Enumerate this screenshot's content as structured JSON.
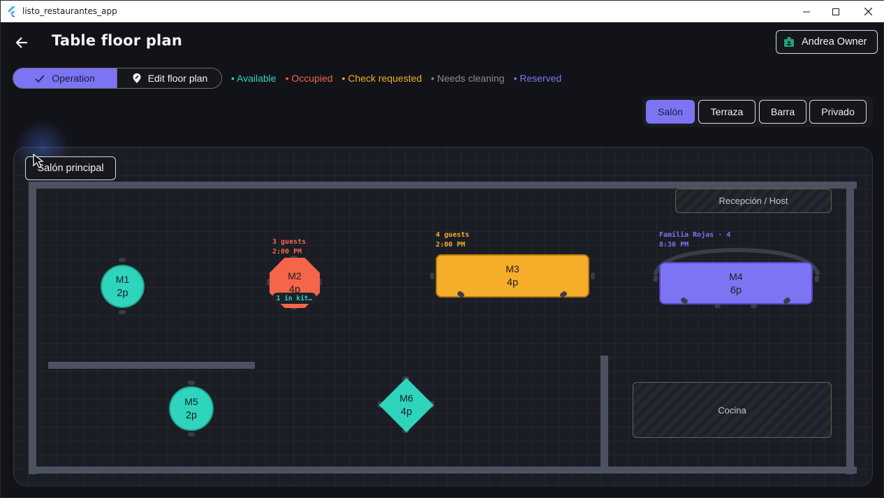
{
  "window": {
    "title": "listo_restaurantes_app"
  },
  "header": {
    "title": "Table floor plan",
    "user_label": "Andrea Owner"
  },
  "mode": {
    "operation_label": "Operation",
    "edit_label": "Edit floor plan"
  },
  "legend": [
    {
      "label": "• Available",
      "color": "#2fd4bc"
    },
    {
      "label": "• Occupied",
      "color": "#f4654a"
    },
    {
      "label": "• Check requested",
      "color": "#f5ad2a"
    },
    {
      "label": "• Needs cleaning",
      "color": "#8a8d96"
    },
    {
      "label": "• Reserved",
      "color": "#7c74f2"
    }
  ],
  "areas": {
    "tabs": [
      "Salón",
      "Terraza",
      "Barra",
      "Privado"
    ],
    "active": "Salón"
  },
  "floor": {
    "room_label": "Salón principal",
    "zones": {
      "host": "Recepción / Host",
      "kitchen": "Cocina"
    },
    "tables": {
      "m1": {
        "name": "M1",
        "capacity": "2p"
      },
      "m2": {
        "name": "M2",
        "capacity": "4p",
        "info_line1": "3 guests",
        "info_line2": "2:00 PM",
        "kitchen": "1 in kit…"
      },
      "m3": {
        "name": "M3",
        "capacity": "4p",
        "info_line1": "4 guests",
        "info_line2": "2:00 PM"
      },
      "m4": {
        "name": "M4",
        "capacity": "6p",
        "info_line1": "Familia Rojas · 4",
        "info_line2": "8:36 PM"
      },
      "m5": {
        "name": "M5",
        "capacity": "2p"
      },
      "m6": {
        "name": "M6",
        "capacity": "4p"
      }
    }
  },
  "colors": {
    "available": "#2fd4bc",
    "occupied": "#f4654a",
    "check": "#f5ad2a",
    "reserved": "#7c74f2",
    "accent": "#7c74f2"
  }
}
